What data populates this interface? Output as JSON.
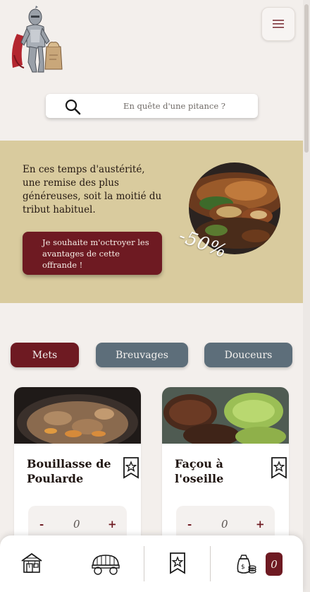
{
  "header": {
    "logo_icon": "knight-logo-icon",
    "menu_icon": "hamburger-menu-icon"
  },
  "search": {
    "placeholder": "En quête d'une pitance ?",
    "value": "",
    "icon": "search-icon"
  },
  "promo": {
    "text": "En ces temps d'austérité, une remise des plus généreuses, soit la moitié du tribut habituel.",
    "button_label": "Je souhaite m'octroyer les avantages de cette offrande !",
    "discount": "-50%",
    "background_color": "#d9cb9e"
  },
  "tabs": [
    {
      "label": "Mets",
      "active": true
    },
    {
      "label": "Breuvages",
      "active": false
    },
    {
      "label": "Douceurs",
      "active": false
    }
  ],
  "products": [
    {
      "name": "Bouillasse de Poularde",
      "quantity": "0",
      "minus": "-",
      "plus": "+"
    },
    {
      "name": "Façou à l'oseille",
      "quantity": "0",
      "minus": "-",
      "plus": "+"
    }
  ],
  "bottom_nav": {
    "items": [
      "tavern-icon",
      "wagon-icon",
      "bookmark-star-icon",
      "money-bag-icon"
    ],
    "cart_count": "0"
  },
  "colors": {
    "accent": "#6e1a22",
    "secondary": "#5d6e7a",
    "background": "#f3efec"
  }
}
